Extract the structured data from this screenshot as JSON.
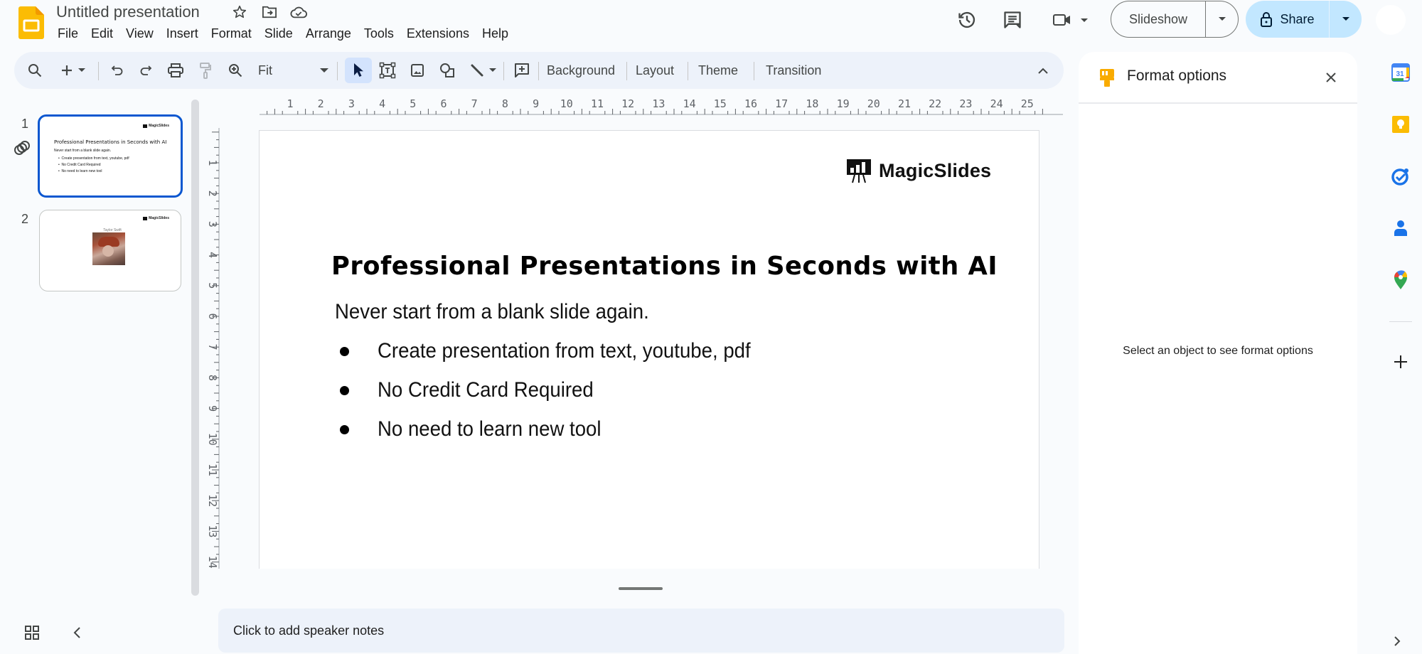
{
  "app": {
    "name": "Google Slides",
    "document_title": "Untitled presentation",
    "title_icons": [
      "star-icon",
      "move-to-folder-icon",
      "cloud-saved-icon"
    ]
  },
  "menu": [
    "File",
    "Edit",
    "View",
    "Insert",
    "Format",
    "Slide",
    "Arrange",
    "Tools",
    "Extensions",
    "Help"
  ],
  "header_actions": {
    "history_icon": "version-history-icon",
    "comments_icon": "comments-icon",
    "meet_icon": "video-call-icon",
    "slideshow_label": "Slideshow",
    "share_label": "Share"
  },
  "toolbar": {
    "zoom_value": "Fit",
    "text_buttons": [
      "Background",
      "Layout",
      "Theme",
      "Transition"
    ]
  },
  "filmstrip": {
    "slides": [
      {
        "number": "1",
        "active": true,
        "logo": "MagicSlides",
        "title": "Professional Presentations in Seconds with AI",
        "subtitle": "Never start from a blank slide again.",
        "bullets": [
          "Create presentation from text, youtube, pdf",
          "No Credit Card Required",
          "No need to learn new tool"
        ]
      },
      {
        "number": "2",
        "active": false,
        "logo": "MagicSlides",
        "caption": "Taylor Swift"
      }
    ]
  },
  "rulers": {
    "horizontal": [
      "1",
      "2",
      "3",
      "4",
      "5",
      "6",
      "7",
      "8",
      "9",
      "10",
      "11",
      "12",
      "13",
      "14",
      "15",
      "16",
      "17",
      "18",
      "19",
      "20",
      "21",
      "22",
      "23",
      "24",
      "25"
    ],
    "vertical": [
      "1",
      "2",
      "3",
      "4",
      "5",
      "6",
      "7",
      "8",
      "9",
      "10",
      "11",
      "12",
      "13",
      "14"
    ]
  },
  "slide": {
    "logo_text": "MagicSlides",
    "title": "Professional Presentations in Seconds with AI",
    "subtitle": "Never start from a blank slide again.",
    "bullets": [
      "Create presentation from text, youtube, pdf",
      "No Credit Card Required",
      "No need to learn new tool"
    ]
  },
  "speaker_notes": {
    "placeholder": "Click to add speaker notes"
  },
  "format_panel": {
    "title": "Format options",
    "empty_message": "Select an object to see format options"
  },
  "side_apps": [
    "Calendar",
    "Keep",
    "Tasks",
    "Contacts",
    "Maps"
  ],
  "colors": {
    "accent_blue": "#0b57d0",
    "share_bg": "#c2e7ff",
    "toolbar_bg": "#edf2fa",
    "slides_yellow": "#fbbc04"
  }
}
